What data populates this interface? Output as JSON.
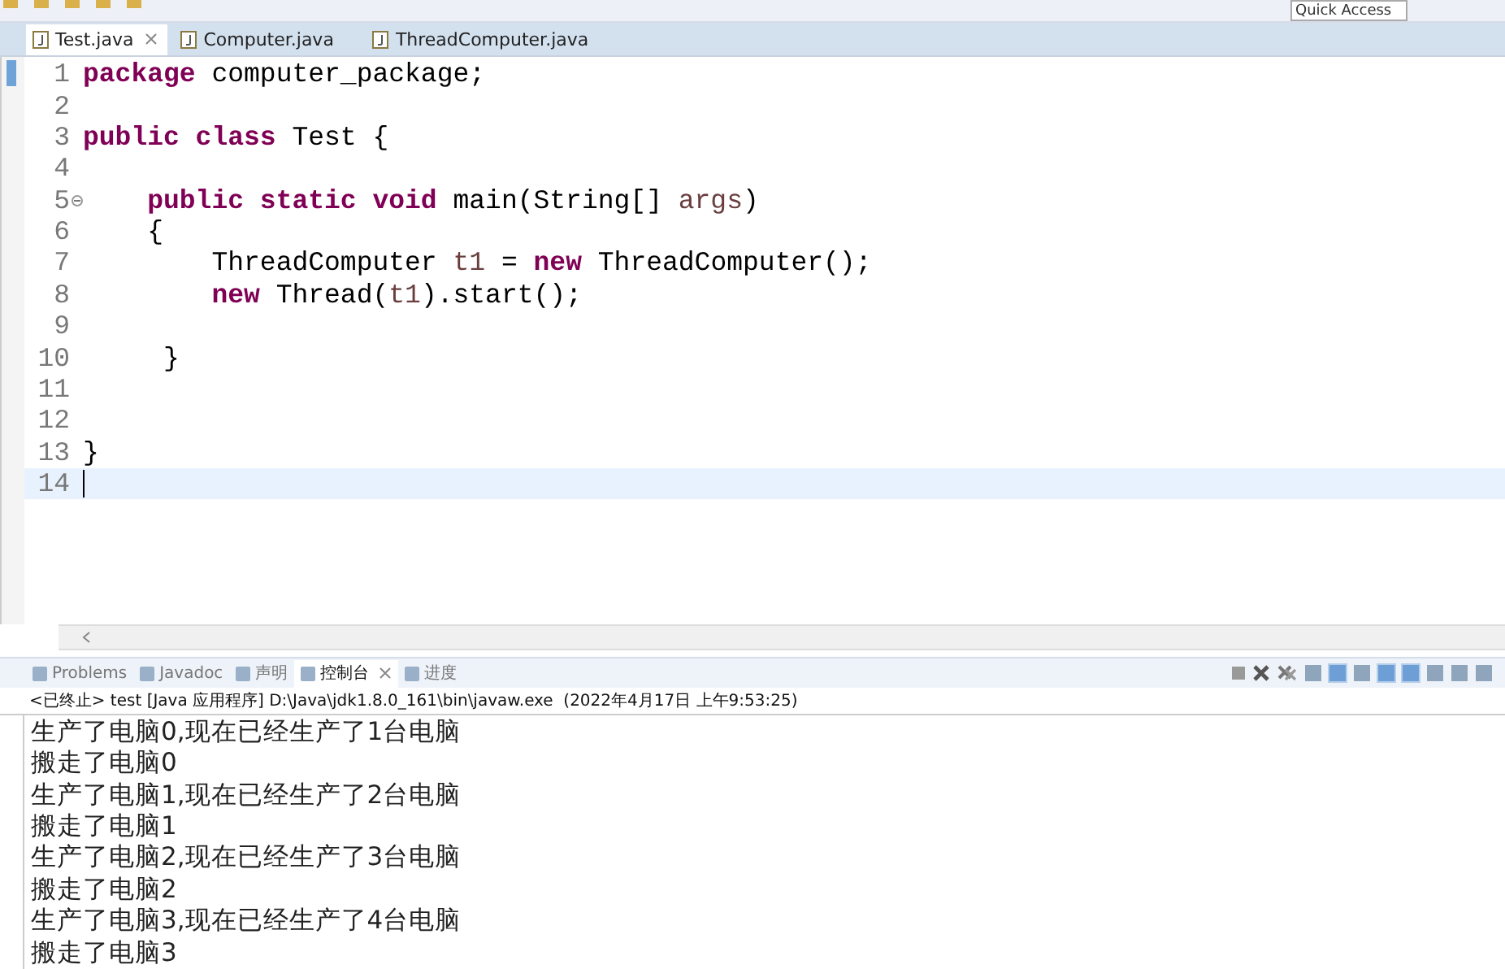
{
  "toolbar": {
    "quick_access": {
      "placeholder": "Quick Access"
    }
  },
  "editor_tabs": [
    {
      "label": "Test.java",
      "selected": true,
      "closable": true
    },
    {
      "label": "Computer.java",
      "selected": false
    },
    {
      "label": "ThreadComputer.java",
      "selected": false
    }
  ],
  "editor": {
    "lines": [
      {
        "number": "1",
        "tokens": [
          {
            "kind": "keyword",
            "text": "package"
          },
          {
            "kind": "plain",
            "text": " computer_package;"
          }
        ]
      },
      {
        "number": "2"
      },
      {
        "number": "3",
        "tokens": [
          {
            "kind": "keyword",
            "text": "public class"
          },
          {
            "kind": "plain",
            "text": " Test {"
          }
        ]
      },
      {
        "number": "4"
      },
      {
        "number": "5",
        "foldable": true,
        "tokens": [
          {
            "kind": "keyword",
            "text": "    public static void"
          },
          {
            "kind": "plain",
            "text": " main(String[] "
          },
          {
            "kind": "variable",
            "text": "args"
          },
          {
            "kind": "plain",
            "text": ")"
          }
        ]
      },
      {
        "number": "6",
        "tokens": [
          {
            "kind": "plain",
            "text": "    {"
          }
        ]
      },
      {
        "number": "7",
        "tokens": [
          {
            "kind": "plain",
            "text": "        ThreadComputer "
          },
          {
            "kind": "variable",
            "text": "t1"
          },
          {
            "kind": "plain",
            "text": " = "
          },
          {
            "kind": "keyword",
            "text": "new"
          },
          {
            "kind": "plain",
            "text": " ThreadComputer();"
          }
        ]
      },
      {
        "number": "8",
        "tokens": [
          {
            "kind": "keyword",
            "text": "        new"
          },
          {
            "kind": "plain",
            "text": " Thread("
          },
          {
            "kind": "variable",
            "text": "t1"
          },
          {
            "kind": "plain",
            "text": ").start();"
          }
        ]
      },
      {
        "number": "9"
      },
      {
        "number": "10",
        "tokens": [
          {
            "kind": "plain",
            "text": "     }"
          }
        ]
      },
      {
        "number": "11"
      },
      {
        "number": "12"
      },
      {
        "number": "13",
        "tokens": [
          {
            "kind": "plain",
            "text": "}"
          }
        ]
      },
      {
        "number": "14",
        "current": true
      }
    ]
  },
  "console_tabs": [
    {
      "label": "Problems",
      "selected": false
    },
    {
      "label": "Javadoc",
      "selected": false
    },
    {
      "label": "声明",
      "selected": false
    },
    {
      "label": "控制台",
      "selected": true,
      "closable": true
    },
    {
      "label": "进度",
      "selected": false
    }
  ],
  "console": {
    "header": "<已终止> test [Java 应用程序] D:\\Java\\jdk1.8.0_161\\bin\\javaw.exe  (2022年4月17日 上午9:53:25)",
    "output": [
      "生产了电脑0,现在已经生产了1台电脑",
      "搬走了电脑0",
      "生产了电脑1,现在已经生产了2台电脑",
      "搬走了电脑1",
      "生产了电脑2,现在已经生产了3台电脑",
      "搬走了电脑2",
      "生产了电脑3,现在已经生产了4台电脑",
      "搬走了电脑3"
    ]
  }
}
